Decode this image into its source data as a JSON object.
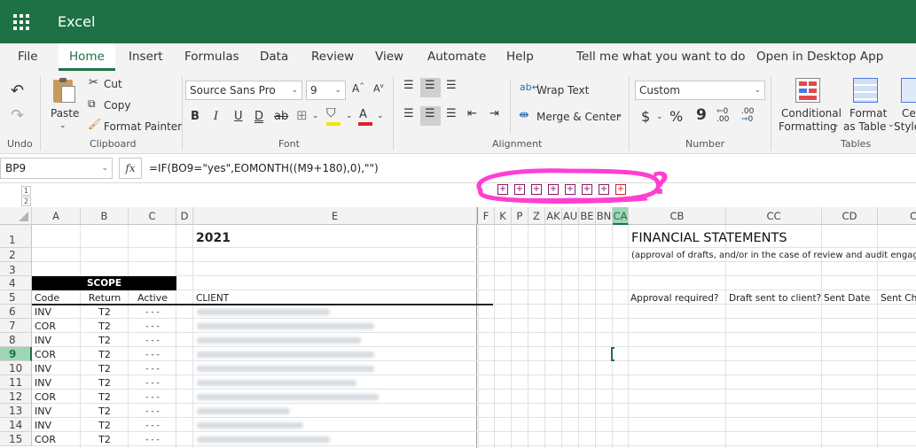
{
  "app": {
    "title": "Excel"
  },
  "tabs": [
    "File",
    "Home",
    "Insert",
    "Formulas",
    "Data",
    "Review",
    "View",
    "Automate",
    "Help",
    "Tell me what you want to do",
    "Open in Desktop App"
  ],
  "ribbon": {
    "undo_group": "Undo",
    "clipboard": {
      "paste": "Paste",
      "cut": "Cut",
      "copy": "Copy",
      "format_painter": "Format Painter",
      "label": "Clipboard"
    },
    "font": {
      "name": "Source Sans Pro",
      "size": "9",
      "label": "Font",
      "bold": "B",
      "italic": "I",
      "underline": "U",
      "double_underline": "D",
      "strike": "ab"
    },
    "alignment": {
      "wrap": "Wrap Text",
      "merge": "Merge & Center",
      "label": "Alignment"
    },
    "number": {
      "format": "Custom",
      "currency": "$",
      "percent": "%",
      "comma": "9",
      "inc_decimal": ".00",
      "dec_decimal": ".00",
      "label": "Number"
    },
    "tables": {
      "conditional": "Conditional",
      "formatting": "Formatting",
      "format": "Format",
      "as_table": "as Table",
      "cell": "Ce",
      "styles": "Style",
      "label": "Tables"
    }
  },
  "formula_bar": {
    "name_box": "BP9",
    "fx": "fx",
    "formula": "=IF(BO9=\"yes\",EOMONTH((M9+180),0),\"\")"
  },
  "outline_levels": [
    "1",
    "2"
  ],
  "group_buttons": [
    "+",
    "+",
    "+",
    "+",
    "+",
    "+",
    "+",
    "+"
  ],
  "annotation_mark": "?",
  "columns": [
    "A",
    "B",
    "C",
    "D",
    "E",
    "F",
    "K",
    "P",
    "Z",
    "AK",
    "AU",
    "BE",
    "BN",
    "CA",
    "CB",
    "CC",
    "CD",
    "C"
  ],
  "rows": [
    "1",
    "2",
    "3",
    "4",
    "5",
    "6",
    "7",
    "8",
    "9",
    "10",
    "11",
    "12",
    "13",
    "14",
    "15"
  ],
  "sheet": {
    "year": "2021",
    "scope": "SCOPE",
    "headers": {
      "code": "Code",
      "return": "Return",
      "active": "Active",
      "client": "CLIENT",
      "approval": "Approval required?",
      "draft": "Draft sent to client?",
      "sent_date": "Sent Date",
      "sent_ch": "Sent Ch"
    },
    "fs_title": "FINANCIAL STATEMENTS",
    "fs_subtitle": "(approval of drafts, and/or in the case of review and audit engage",
    "data_rows": [
      {
        "code": "INV",
        "ret": "T2",
        "active": "- - -"
      },
      {
        "code": "COR",
        "ret": "T2",
        "active": "- - -"
      },
      {
        "code": "INV",
        "ret": "T2",
        "active": "- - -"
      },
      {
        "code": "COR",
        "ret": "T2",
        "active": "- - -"
      },
      {
        "code": "INV",
        "ret": "T2",
        "active": "- - -"
      },
      {
        "code": "INV",
        "ret": "T2",
        "active": "- - -"
      },
      {
        "code": "COR",
        "ret": "T2",
        "active": "- - -"
      },
      {
        "code": "INV",
        "ret": "T2",
        "active": "- - -"
      },
      {
        "code": "INV",
        "ret": "T2",
        "active": "- - -"
      },
      {
        "code": "COR",
        "ret": "T2",
        "active": "- - -"
      }
    ]
  },
  "colors": {
    "brand": "#1e7145",
    "annotation": "#ff3fd2",
    "header_bg": "#f3f3f3"
  }
}
